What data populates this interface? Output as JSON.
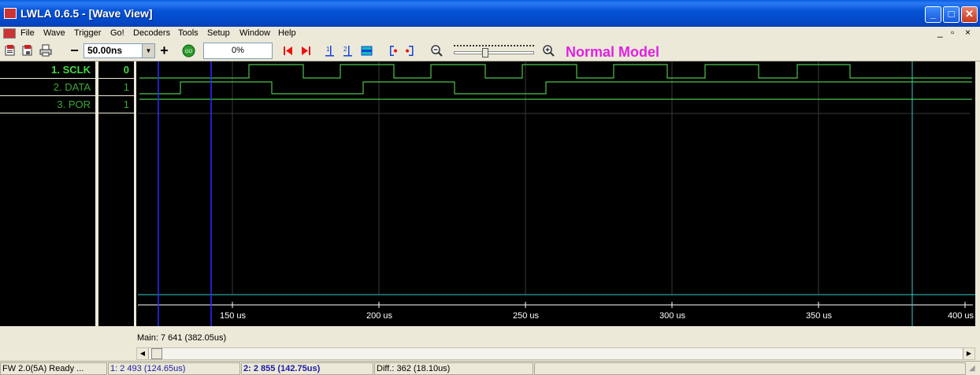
{
  "window": {
    "title": "LWLA 0.6.5 - [Wave View]",
    "app_icon_label": "LWLA",
    "min_glyph": "_",
    "max_glyph": "□",
    "close_glyph": "✕"
  },
  "menu": {
    "items": [
      "File",
      "Wave",
      "Trigger",
      "Go!",
      "Decoders",
      "Tools",
      "Setup",
      "Window",
      "Help"
    ],
    "mdi_min": "_",
    "mdi_restore": "▫",
    "mdi_close": "×"
  },
  "toolbar": {
    "zoom_minus": "−",
    "zoom_value": "50.00ns",
    "zoom_plus": "+",
    "go_label": "GO",
    "progress": "0%",
    "mode_label": "Normal Model",
    "slider_level": 0.38
  },
  "signals": [
    {
      "name": "1. SCLK",
      "value": "0",
      "active": true
    },
    {
      "name": "2. DATA",
      "value": "1",
      "active": false
    },
    {
      "name": "3. POR",
      "value": "1",
      "active": false
    }
  ],
  "timeline": {
    "ticks": [
      "150 us",
      "200 us",
      "250 us",
      "300 us",
      "350 us",
      "400 us"
    ]
  },
  "info": {
    "main": "Main: 7 641  (382.05us)"
  },
  "status": {
    "fw": "FW 2.0(5A) Ready ...",
    "cursor1": "1: 2 493  (124.65us)",
    "cursor2": "2: 2 855  (142.75us)",
    "diff": "Diff.: 362  (18.10us)"
  },
  "colors": {
    "signal": "#4ec24e",
    "grid": "#3a3a3a",
    "cursor_blue": "#2a2aff",
    "cursor_cyan": "#33cccc",
    "mode": "#e020e0"
  }
}
